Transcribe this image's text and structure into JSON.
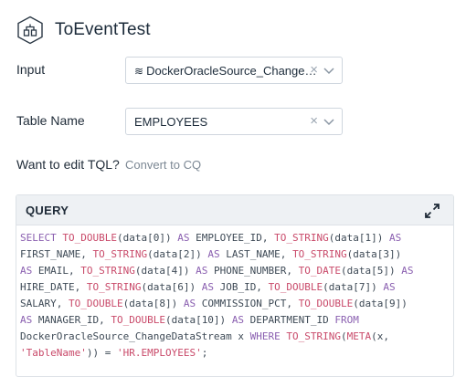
{
  "header": {
    "title": "ToEventTest",
    "icon": "event-transform-icon"
  },
  "input": {
    "label": "Input",
    "value": "DockerOracleSource_Change…",
    "value_icon": "stream-icon"
  },
  "table_name": {
    "label": "Table Name",
    "value": "EMPLOYEES"
  },
  "edit_tql": {
    "label": "Want to edit TQL?",
    "link": "Convert to CQ"
  },
  "query": {
    "title": "QUERY",
    "lines": [
      [
        {
          "t": "SELECT ",
          "c": "kw"
        },
        {
          "t": "TO_DOUBLE",
          "c": "fn"
        },
        {
          "t": "(data[0]) "
        },
        {
          "t": "AS",
          "c": "kw"
        },
        {
          "t": " EMPLOYEE_ID, "
        },
        {
          "t": "TO_STRING",
          "c": "fn"
        },
        {
          "t": "(data[1]) "
        },
        {
          "t": "AS",
          "c": "kw"
        }
      ],
      [
        {
          "t": "FIRST_NAME, "
        },
        {
          "t": "TO_STRING",
          "c": "fn"
        },
        {
          "t": "(data[2]) "
        },
        {
          "t": "AS",
          "c": "kw"
        },
        {
          "t": " LAST_NAME, "
        },
        {
          "t": "TO_STRING",
          "c": "fn"
        },
        {
          "t": "(data[3])"
        }
      ],
      [
        {
          "t": "AS",
          "c": "kw"
        },
        {
          "t": " EMAIL, "
        },
        {
          "t": "TO_STRING",
          "c": "fn"
        },
        {
          "t": "(data[4]) "
        },
        {
          "t": "AS",
          "c": "kw"
        },
        {
          "t": " PHONE_NUMBER, "
        },
        {
          "t": "TO_DATE",
          "c": "fn"
        },
        {
          "t": "(data[5]) "
        },
        {
          "t": "AS",
          "c": "kw"
        }
      ],
      [
        {
          "t": "HIRE_DATE, "
        },
        {
          "t": "TO_STRING",
          "c": "fn"
        },
        {
          "t": "(data[6]) "
        },
        {
          "t": "AS",
          "c": "kw"
        },
        {
          "t": " JOB_ID, "
        },
        {
          "t": "TO_DOUBLE",
          "c": "fn"
        },
        {
          "t": "(data[7]) "
        },
        {
          "t": "AS",
          "c": "kw"
        }
      ],
      [
        {
          "t": "SALARY, "
        },
        {
          "t": "TO_DOUBLE",
          "c": "fn"
        },
        {
          "t": "(data[8]) "
        },
        {
          "t": "AS",
          "c": "kw"
        },
        {
          "t": " COMMISSION_PCT, "
        },
        {
          "t": "TO_DOUBLE",
          "c": "fn"
        },
        {
          "t": "(data[9])"
        }
      ],
      [
        {
          "t": "AS",
          "c": "kw"
        },
        {
          "t": " MANAGER_ID, "
        },
        {
          "t": "TO_DOUBLE",
          "c": "fn"
        },
        {
          "t": "(data[10]) "
        },
        {
          "t": "AS",
          "c": "kw"
        },
        {
          "t": " DEPARTMENT_ID "
        },
        {
          "t": "FROM",
          "c": "kw"
        }
      ],
      [
        {
          "t": "DockerOracleSource_ChangeDataStream x "
        },
        {
          "t": "WHERE",
          "c": "kw"
        },
        {
          "t": " "
        },
        {
          "t": "TO_STRING",
          "c": "fn"
        },
        {
          "t": "("
        },
        {
          "t": "META",
          "c": "fn"
        },
        {
          "t": "(x,"
        }
      ],
      [
        {
          "t": "'TableName'",
          "c": "str"
        },
        {
          "t": ")) = "
        },
        {
          "t": "'HR.EMPLOYEES'",
          "c": "str"
        },
        {
          "t": ";"
        }
      ]
    ]
  }
}
